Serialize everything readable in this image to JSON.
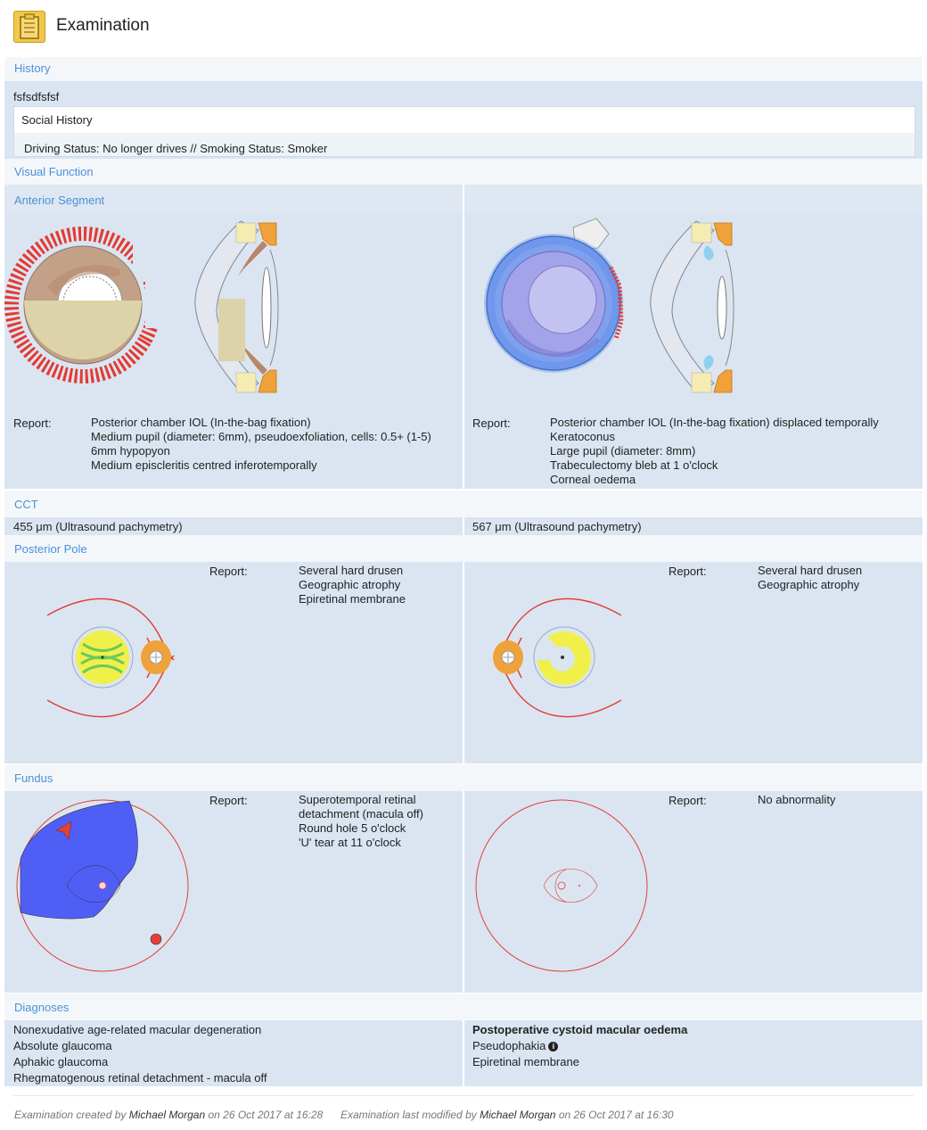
{
  "header": {
    "title": "Examination",
    "icon": "clipboard-icon"
  },
  "history": {
    "section_title": "History",
    "text": "fsfsdfsfsf",
    "social_history": {
      "title": "Social History",
      "text": "Driving Status: No longer drives // Smoking Status: Smoker"
    }
  },
  "visual_function": {
    "section_title": "Visual Function"
  },
  "anterior_segment": {
    "section_title": "Anterior Segment",
    "right": {
      "report_label": "Report:",
      "lines": [
        "Posterior chamber IOL (In-the-bag fixation)",
        "Medium pupil (diameter: 6mm), pseudoexfoliation, cells: 0.5+ (1-5)",
        "6mm hypopyon",
        "Medium episcleritis centred inferotemporally"
      ]
    },
    "left": {
      "report_label": "Report:",
      "lines": [
        "Posterior chamber IOL (In-the-bag fixation) displaced temporally",
        "Keratoconus",
        "Large pupil (diameter: 8mm)",
        "Trabeculectomy bleb at 1 o'clock",
        "Corneal oedema"
      ]
    }
  },
  "cct": {
    "section_title": "CCT",
    "right_value": "455 μm (Ultrasound pachymetry)",
    "left_value": "567 μm (Ultrasound pachymetry)"
  },
  "posterior_pole": {
    "section_title": "Posterior Pole",
    "right": {
      "report_label": "Report:",
      "lines": [
        "Several hard drusen",
        "Geographic atrophy",
        "Epiretinal membrane"
      ]
    },
    "left": {
      "report_label": "Report:",
      "lines": [
        "Several hard drusen",
        "Geographic atrophy"
      ]
    }
  },
  "fundus": {
    "section_title": "Fundus",
    "right": {
      "report_label": "Report:",
      "lines": [
        "Superotemporal retinal",
        "detachment (macula off)",
        "Round hole 5 o'clock",
        "'U' tear at 11 o'clock"
      ]
    },
    "left": {
      "report_label": "Report:",
      "lines": [
        "No abnormality"
      ]
    }
  },
  "diagnoses": {
    "section_title": "Diagnoses",
    "right": [
      "Nonexudative age-related macular degeneration",
      "Absolute glaucoma",
      "Aphakic glaucoma",
      "Rhegmatogenous retinal detachment - macula off"
    ],
    "left_bold": "Postoperative cystoid macular oedema",
    "left": [
      "Pseudophakia",
      "Epiretinal membrane"
    ]
  },
  "footer": {
    "created_prefix": "Examination created by",
    "created_by": "Michael Morgan",
    "created_on": "on 26 Oct 2017 at 16:28",
    "modified_prefix": "Examination last modified by",
    "modified_by": "Michael Morgan",
    "modified_on": "on 26 Oct 2017 at 16:30"
  },
  "colors": {
    "accent": "#4a90d9",
    "panel": "#dbe5f1",
    "retina_red": "#e0413a",
    "detachment_blue": "#4f5ef5"
  }
}
